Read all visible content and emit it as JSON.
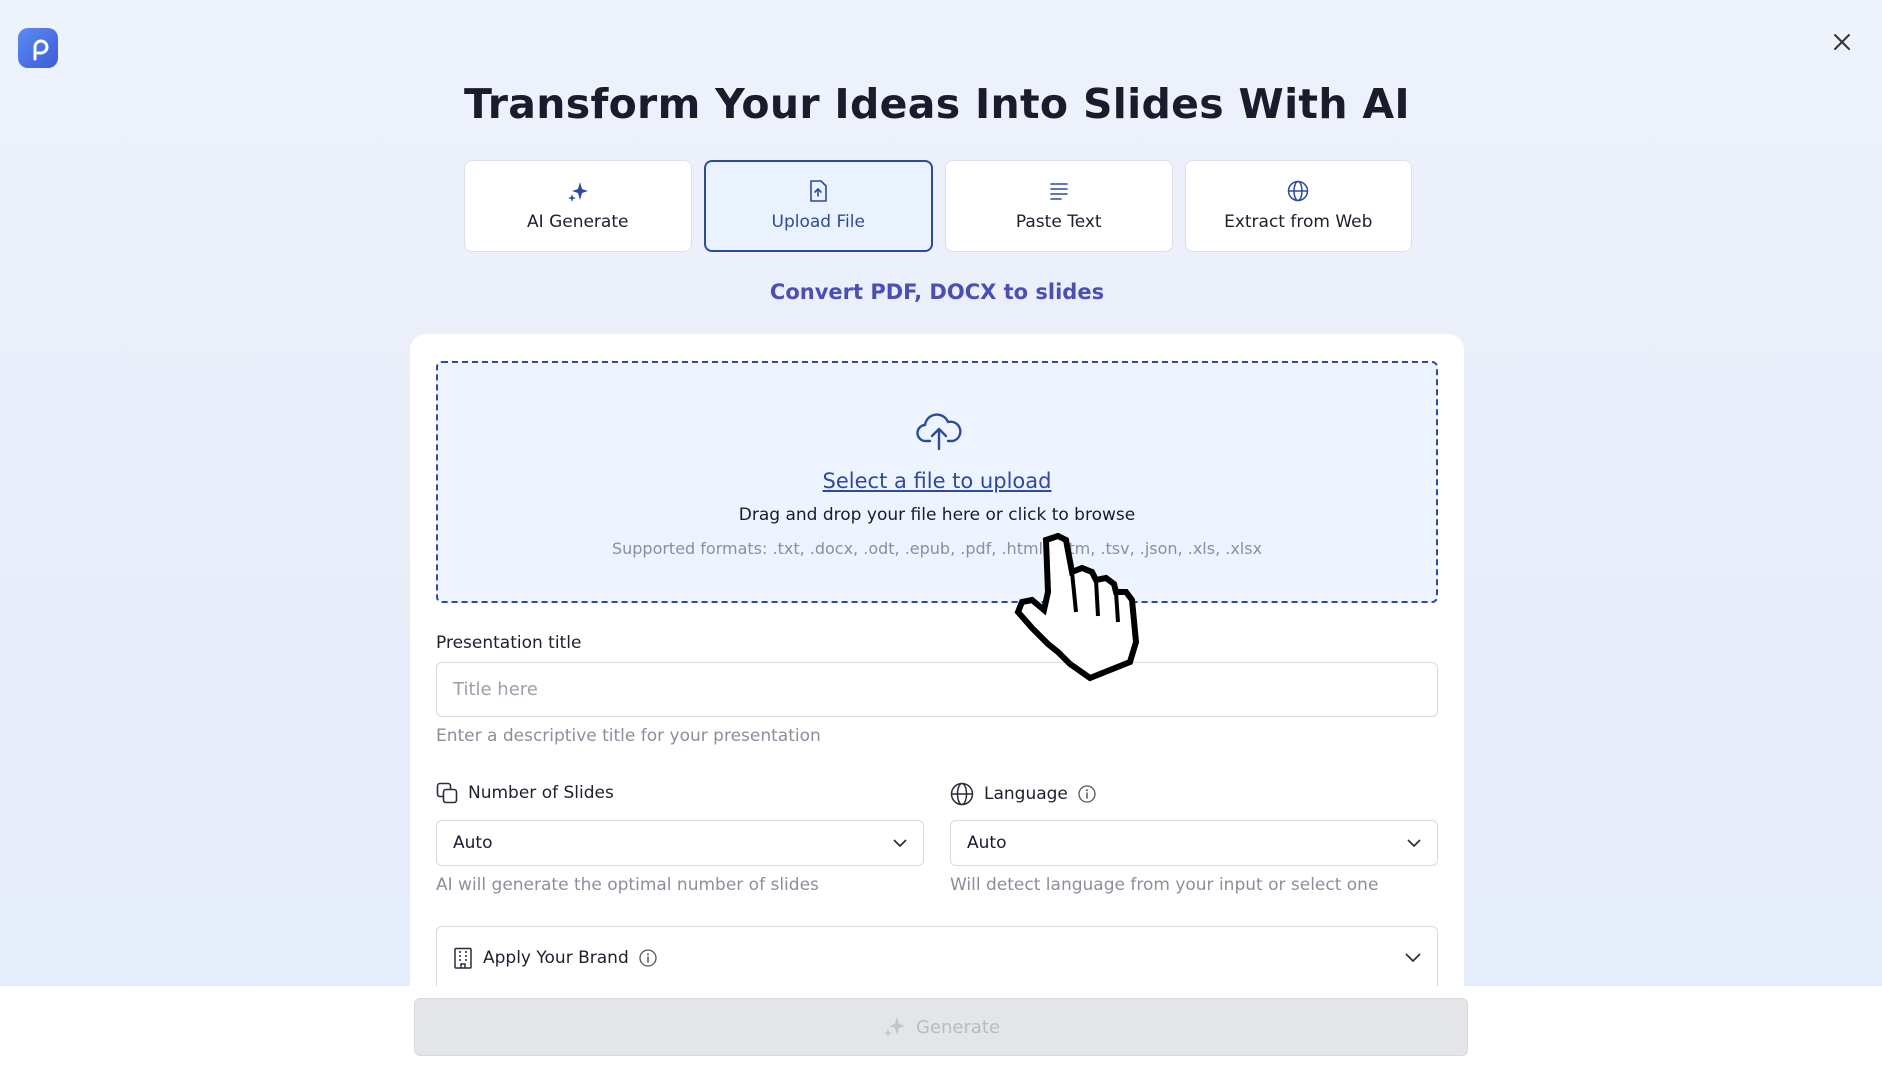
{
  "app": {
    "logo_icon": "presentation-logo-icon"
  },
  "header": {
    "title": "Transform Your Ideas Into Slides With AI",
    "close_icon": "close-icon"
  },
  "tabs": [
    {
      "label": "AI Generate",
      "icon": "sparkle-icon",
      "active": false
    },
    {
      "label": "Upload File",
      "icon": "file-upload-icon",
      "active": true
    },
    {
      "label": "Paste Text",
      "icon": "text-lines-icon",
      "active": false
    },
    {
      "label": "Extract from Web",
      "icon": "globe-icon",
      "active": false
    }
  ],
  "subtitle": "Convert PDF, DOCX to slides",
  "upload": {
    "icon": "cloud-upload-icon",
    "link_text": "Select a file to upload",
    "description": "Drag and drop your file here or click to browse",
    "formats": "Supported formats: .txt, .docx, .odt, .epub, .pdf, .html, .htm, .tsv, .json, .xls, .xlsx"
  },
  "presentation_title": {
    "label": "Presentation title",
    "placeholder": "Title here",
    "value": "",
    "hint": "Enter a descriptive title for your presentation"
  },
  "slides": {
    "label": "Number of Slides",
    "icon": "copy-slides-icon",
    "value": "Auto",
    "hint": "AI will generate the optimal number of slides"
  },
  "language": {
    "label": "Language",
    "icon": "globe-icon",
    "info_icon": "info-icon",
    "value": "Auto",
    "hint": "Will detect language from your input or select one"
  },
  "brand": {
    "label": "Apply Your Brand",
    "icon": "building-icon",
    "info_icon": "info-icon"
  },
  "generate": {
    "label": "Generate",
    "icon": "sparkle-icon",
    "disabled": true
  },
  "colors": {
    "accent": "#2d4a9e",
    "subtitle": "#4a4fb5",
    "active_tab_bg": "#eaf2ff",
    "dropzone_bg": "#edf4ff"
  }
}
